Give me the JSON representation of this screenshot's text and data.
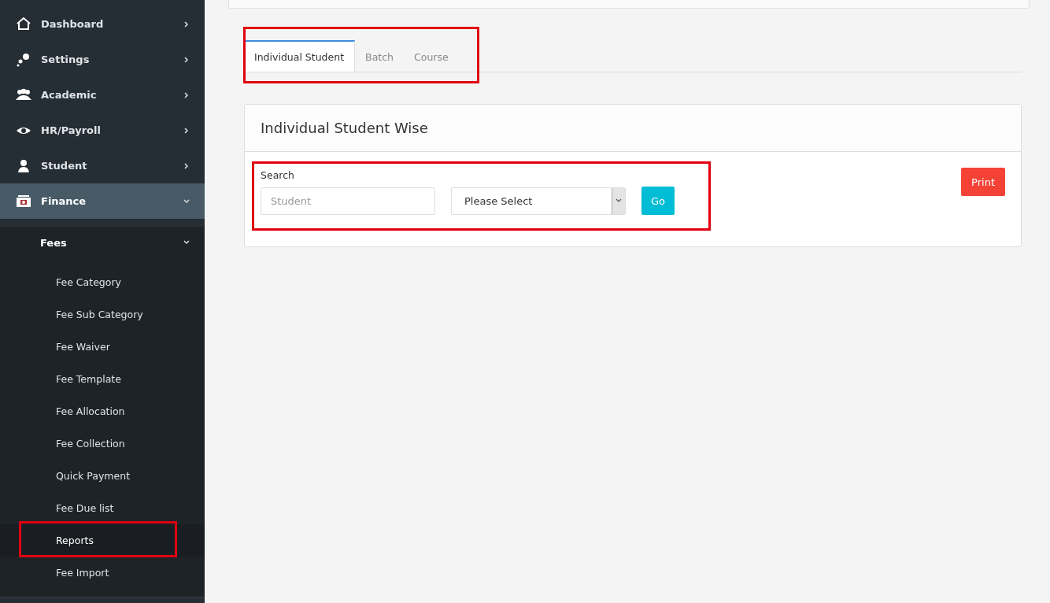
{
  "sidebar": {
    "items": [
      {
        "label": "Dashboard",
        "expanded": false,
        "selected": false
      },
      {
        "label": "Settings",
        "expanded": false,
        "selected": false
      },
      {
        "label": "Academic",
        "expanded": false,
        "selected": false
      },
      {
        "label": "HR/Payroll",
        "expanded": false,
        "selected": false
      },
      {
        "label": "Student",
        "expanded": false,
        "selected": false
      },
      {
        "label": "Finance",
        "expanded": true,
        "selected": true,
        "children": [
          {
            "label": "Fees",
            "expanded": true,
            "children": [
              {
                "label": "Fee Category",
                "selected": false
              },
              {
                "label": "Fee Sub Category",
                "selected": false
              },
              {
                "label": "Fee Waiver",
                "selected": false
              },
              {
                "label": "Fee Template",
                "selected": false
              },
              {
                "label": "Fee Allocation",
                "selected": false
              },
              {
                "label": "Fee Collection",
                "selected": false
              },
              {
                "label": "Quick Payment",
                "selected": false
              },
              {
                "label": "Fee Due list",
                "selected": false
              },
              {
                "label": "Reports",
                "selected": true
              },
              {
                "label": "Fee Import",
                "selected": false
              }
            ]
          }
        ]
      }
    ]
  },
  "tabs": [
    {
      "label": "Individual Student",
      "selected": true
    },
    {
      "label": "Batch",
      "selected": false
    },
    {
      "label": "Course",
      "selected": false
    }
  ],
  "panel": {
    "title": "Individual Student Wise",
    "search_label": "Search",
    "student_field": {
      "placeholder": "Student"
    },
    "select": {
      "value": "Please Select"
    },
    "go_button": "Go",
    "print_button": "Print"
  }
}
